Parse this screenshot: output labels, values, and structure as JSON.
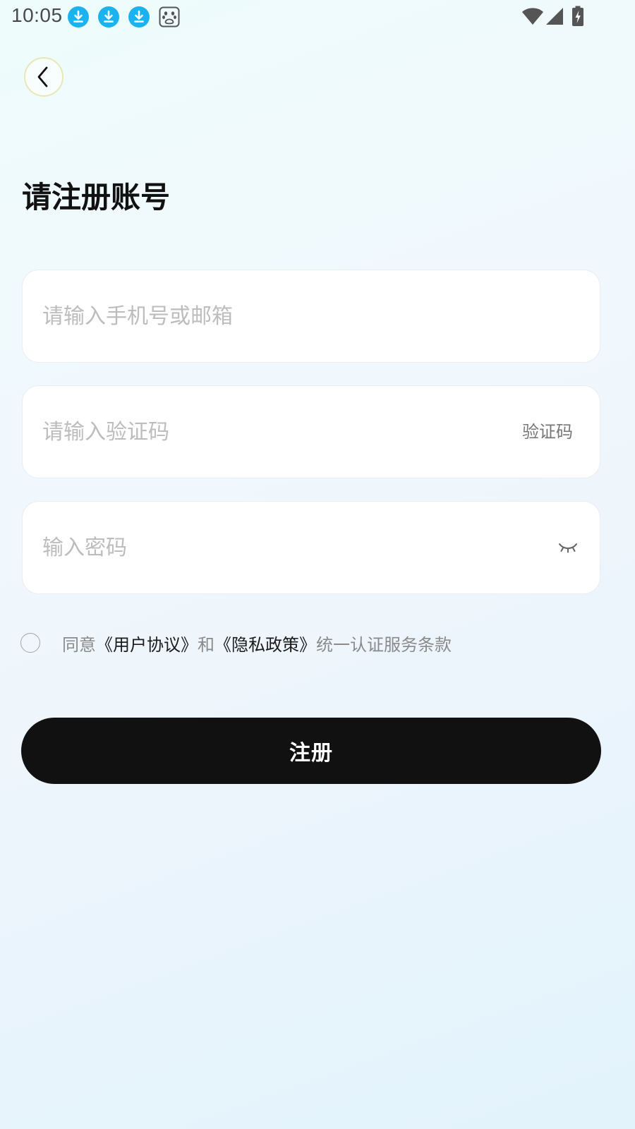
{
  "status_bar": {
    "time": "10:05",
    "notification_icons": [
      "download-icon",
      "download-icon",
      "download-icon",
      "baidu-paw-icon"
    ],
    "system_icons": [
      "wifi-icon",
      "cellular-signal-icon",
      "battery-charging-icon"
    ]
  },
  "header": {
    "back_icon": "chevron-left-icon"
  },
  "title": "请注册账号",
  "form": {
    "phone_placeholder": "请输入手机号或邮箱",
    "code_placeholder": "请输入验证码",
    "code_button_label": "验证码",
    "password_placeholder": "输入密码",
    "password_toggle_icon": "eye-closed-icon"
  },
  "agreement": {
    "checked": false,
    "prefix": "同意",
    "user_agreement": "《用户协议》",
    "and": "和",
    "privacy_policy": "《隐私政策》",
    "suffix": "统一认证服务条款"
  },
  "register_button_label": "注册",
  "colors": {
    "accent_download": "#1ab3f0",
    "button_bg": "#111111",
    "placeholder": "#bdbdbd",
    "back_button_border": "#e9e7b7"
  }
}
